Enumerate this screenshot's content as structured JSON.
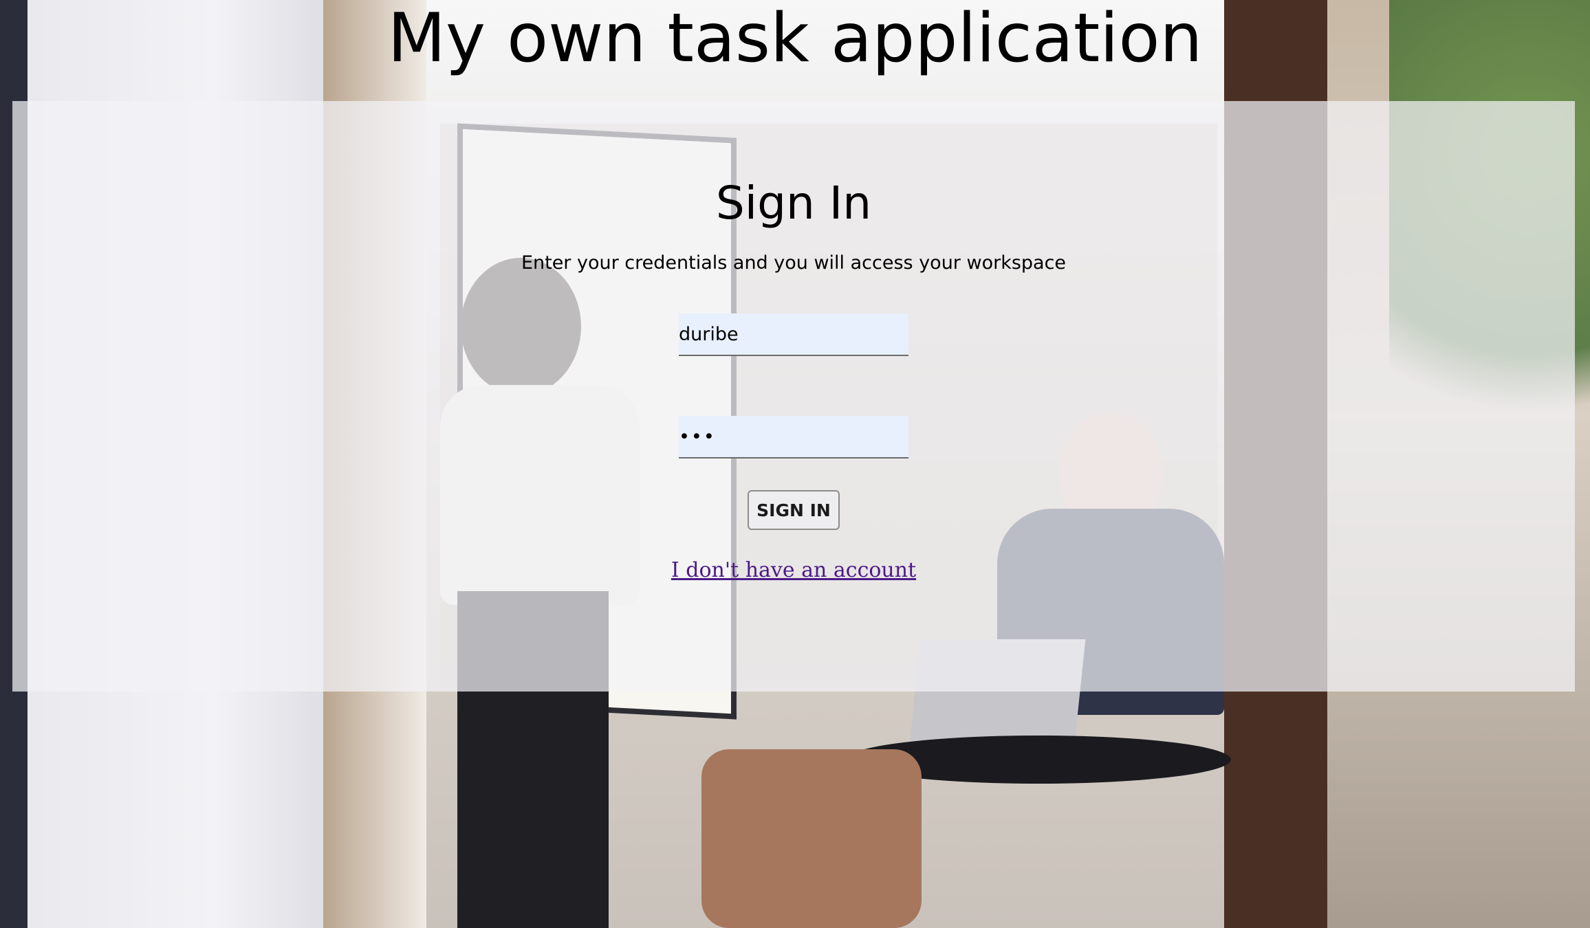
{
  "app": {
    "title": "My own task application"
  },
  "signin": {
    "title": "Sign In",
    "subtitle": "Enter your credentials and you will access your workspace",
    "username_value": "duribe",
    "password_value": "•••",
    "button_label": "SIGN IN",
    "no_account_link": "I don't have an account"
  },
  "colors": {
    "input_background": "#e8effd",
    "link": "#4b1a86",
    "panel_overlay": "#f2f2f6"
  }
}
